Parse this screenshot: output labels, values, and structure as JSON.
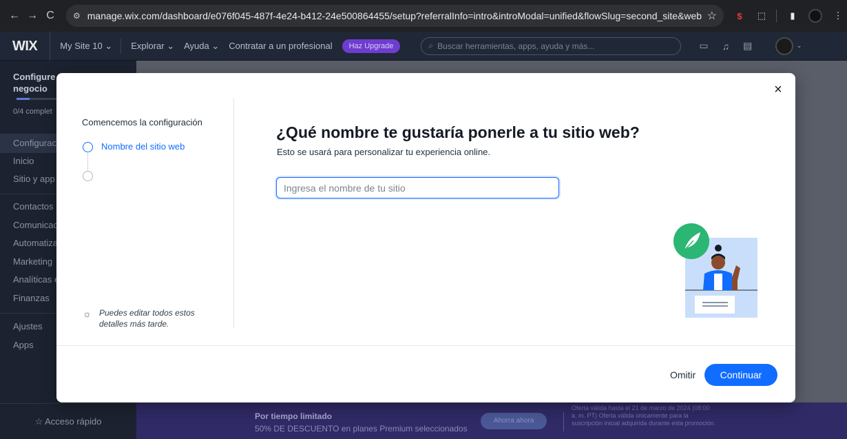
{
  "browser": {
    "back": "←",
    "forward": "→",
    "reload": "C",
    "url": "manage.wix.com/dashboard/e076f045-487f-4e24-b412-24e500864455/setup?referralInfo=intro&introModal=unified&flowSlug=second_site&websiteFor..."
  },
  "topbar": {
    "logo": "WIX",
    "site_selector": "My Site 10 ⌄",
    "menu_explore": "Explorar ⌄",
    "menu_help": "Ayuda ⌄",
    "menu_hire": "Contratar a un profesional",
    "upgrade": "Haz Upgrade",
    "search_placeholder": "Buscar herramientas, apps, ayuda y más..."
  },
  "sidebar": {
    "setup_title": "Configure negocio",
    "progress_text": "0/4 complet",
    "progress_value": 0,
    "items": [
      "Configurac",
      "Inicio",
      "Sitio y app",
      "Contactos",
      "Comunicac",
      "Automatiza",
      "Marketing",
      "Analíticas e",
      "Finanzas",
      "Ajustes",
      "Apps"
    ],
    "quick_access": "☆ Acceso rápido"
  },
  "promo": {
    "title": "Por tiempo limitado",
    "subtitle": "50% DE DESCUENTO en planes Premium seleccionados",
    "button": "Ahorra ahora",
    "note": "Oferta válida hasta el 21 de marzo de 2024 (08:00 a. m. PT) Oferta válida únicamente para la suscripción inicial adquirida durante esta promoción."
  },
  "modal": {
    "steps_title": "Comencemos la configuración",
    "step_current": "Nombre del sitio web",
    "tip": "Puedes editar todos estos detalles más tarde.",
    "heading": "¿Qué nombre te gustaría ponerle a tu sitio web?",
    "description": "Esto se usará para personalizar tu experiencia online.",
    "input_placeholder": "Ingresa el nombre de tu sitio",
    "input_value": "",
    "skip": "Omitir",
    "continue": "Continuar",
    "close": "×"
  },
  "colors": {
    "accent": "#116dff",
    "modal_bg": "#ffffff"
  }
}
